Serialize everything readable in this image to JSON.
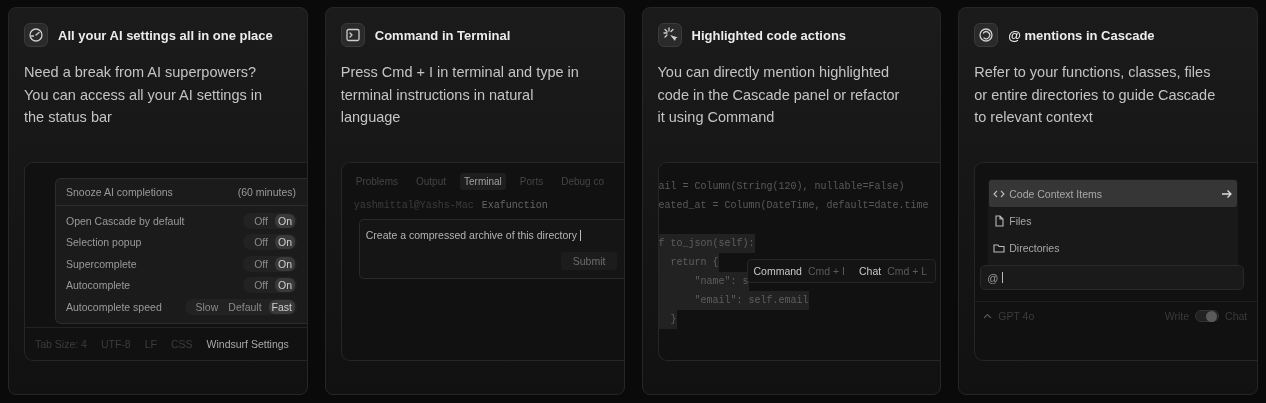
{
  "cards": [
    {
      "kind": "settings",
      "title": "All your AI settings all in one place",
      "description": "Need a break from AI superpowers? You can access all your AI settings in the status bar",
      "snooze": {
        "label": "Snooze AI completions",
        "value": "(60 minutes)"
      },
      "settings": [
        {
          "label": "Open Cascade by default",
          "options": [
            {
              "label": "Off",
              "selected": false
            },
            {
              "label": "On",
              "selected": true
            }
          ]
        },
        {
          "label": "Selection popup",
          "options": [
            {
              "label": "Off",
              "selected": false
            },
            {
              "label": "On",
              "selected": true
            }
          ]
        },
        {
          "label": "Supercomplete",
          "options": [
            {
              "label": "Off",
              "selected": false
            },
            {
              "label": "On",
              "selected": true
            }
          ]
        },
        {
          "label": "Autocomplete",
          "options": [
            {
              "label": "Off",
              "selected": false
            },
            {
              "label": "On",
              "selected": true
            }
          ]
        },
        {
          "label": "Autocomplete speed",
          "options": [
            {
              "label": "Slow",
              "selected": false
            },
            {
              "label": "Default",
              "selected": false
            },
            {
              "label": "Fast",
              "selected": true
            }
          ]
        }
      ],
      "status_bar": [
        {
          "label": "Tab Size: 4",
          "selected": false
        },
        {
          "label": "UTF-8",
          "selected": false
        },
        {
          "label": "LF",
          "selected": false
        },
        {
          "label": "CSS",
          "selected": false
        },
        {
          "label": "Windsurf Settings",
          "selected": true
        }
      ]
    },
    {
      "kind": "terminal",
      "title": "Command in Terminal",
      "description": "Press Cmd + I in terminal and type in terminal instructions in natural language",
      "tabs": [
        {
          "label": "Problems",
          "selected": false
        },
        {
          "label": "Output",
          "selected": false
        },
        {
          "label": "Terminal",
          "selected": true
        },
        {
          "label": "Ports",
          "selected": false
        },
        {
          "label": "Debug co",
          "selected": false
        }
      ],
      "prompt": {
        "user": "yashmittal@Yashs-Mac",
        "directory": "Exafunction"
      },
      "input": {
        "value": "Create a compressed archive of this directory"
      },
      "button": "Submit"
    },
    {
      "kind": "code",
      "title": "Highlighted code actions",
      "description": "You can directly mention highlighted code in the Cascade panel or refactor it using Command",
      "code_blocks": [
        {
          "lines": [
            {
              "text": "ail = Column(String(120), nullable=False)",
              "selected": false
            },
            {
              "text": "eated_at = Column(DateTime, default=date.time",
              "selected": false
            }
          ]
        },
        {
          "lines": [
            {
              "text": "f to_json(self):",
              "selected": true
            },
            {
              "text": "  return {",
              "selected": true
            },
            {
              "text": "      \"name\": s",
              "selected": true
            },
            {
              "text": "      \"email\": self.email",
              "selected": true
            },
            {
              "text": "  }",
              "selected": true
            }
          ]
        }
      ],
      "menu": [
        {
          "label": "Command",
          "shortcut": "Cmd + I"
        },
        {
          "label": "Chat",
          "shortcut": "Cmd + L"
        }
      ]
    },
    {
      "kind": "mentions",
      "title": "@ mentions in Cascade",
      "description": "Refer to your functions, classes, files or entire directories to guide Cascade to relevant context",
      "menu_items": [
        {
          "kind": "code",
          "label": "Code Context Items",
          "selected": true
        },
        {
          "kind": "file",
          "label": "Files",
          "selected": false
        },
        {
          "kind": "folder",
          "label": "Directories",
          "selected": false
        }
      ],
      "input": {
        "value": "@"
      },
      "model": "GPT 4o",
      "mode": {
        "left": "Write",
        "right": "Chat",
        "on": true
      }
    }
  ]
}
